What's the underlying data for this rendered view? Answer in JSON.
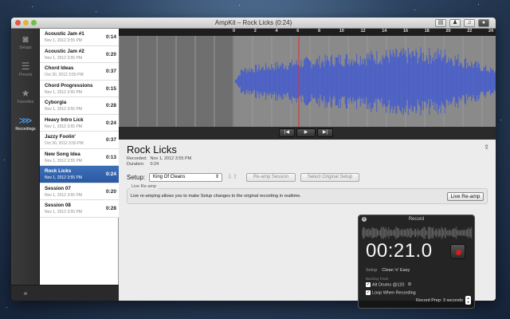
{
  "window": {
    "title": "AmpKit – Rock Licks (0:24)"
  },
  "toolbar": {
    "buttons": [
      {
        "icon": "list-icon",
        "glyph": "▤"
      },
      {
        "icon": "person-icon",
        "glyph": "♟"
      },
      {
        "icon": "music-icon",
        "glyph": "♫"
      },
      {
        "icon": "record-toggle-icon",
        "glyph": "●"
      }
    ]
  },
  "nav": {
    "items": [
      {
        "label": "Setups",
        "icon": "speaker-icon",
        "glyph": "◙"
      },
      {
        "label": "Presets",
        "icon": "sliders-icon",
        "glyph": "☰"
      },
      {
        "label": "Favorites",
        "icon": "star-icon",
        "glyph": "★"
      },
      {
        "label": "Recordings",
        "icon": "waveform-icon",
        "glyph": "⋙"
      }
    ]
  },
  "recordings": [
    {
      "name": "Acoustic Jam #1",
      "date": "Nov 1, 2012 3:55 PM",
      "duration": "0:14"
    },
    {
      "name": "Acoustic Jam #2",
      "date": "Nov 1, 2012 3:55 PM",
      "duration": "0:20"
    },
    {
      "name": "Chord Ideas",
      "date": "Oct 30, 2012 3:55 PM",
      "duration": "0:37"
    },
    {
      "name": "Chord Progressions",
      "date": "Nov 1, 2012 3:55 PM",
      "duration": "0:15"
    },
    {
      "name": "Cyborgia",
      "date": "Nov 1, 2012 3:55 PM",
      "duration": "0:28"
    },
    {
      "name": "Heavy Intro Lick",
      "date": "Nov 1, 2012 3:55 PM",
      "duration": "0:24"
    },
    {
      "name": "Jazzy Foolin'",
      "date": "Oct 30, 2012 3:55 PM",
      "duration": "0:37"
    },
    {
      "name": "New Song Idea",
      "date": "Nov 1, 2012 3:55 PM",
      "duration": "0:13"
    },
    {
      "name": "Rock Licks",
      "date": "Nov 1, 2012 3:55 PM",
      "duration": "0:24"
    },
    {
      "name": "Session 07",
      "date": "Nov 1, 2012 3:55 PM",
      "duration": "0:20"
    },
    {
      "name": "Session 08",
      "date": "Nov 1, 2012 3:55 PM",
      "duration": "0:28"
    }
  ],
  "selected_index": 8,
  "ruler": {
    "ticks": [
      "0",
      "2",
      "4",
      "6",
      "8",
      "10",
      "12",
      "14",
      "16",
      "18",
      "20",
      "22",
      "24"
    ]
  },
  "transport": {
    "prev": "|◀",
    "play": "▶",
    "next": "▶|"
  },
  "details": {
    "title": "Rock Licks",
    "recorded_label": "Recorded:",
    "recorded_value": "Nov 1, 2012 3:55 PM",
    "duration_label": "Duration:",
    "duration_value": "0:24",
    "setup_label": "Setup:",
    "setup_value": "King Of Cleans",
    "reamp_button": "Re-amp Session",
    "select_original_button": "Select Original Setup",
    "live_group_label": "Live Re-amp",
    "live_desc": "Live re-amping allows you to make Setup changes to the original recording in realtime.",
    "live_button": "Live Re-amp"
  },
  "record_hud": {
    "title": "Record",
    "timer": "00:21.0",
    "setup_label": "Setup",
    "setup_value": "Clean 'n' Easy",
    "backing_track_label": "Backing Track",
    "backing_track_value": "Alt Drums @120",
    "loop_label": "Loop When Recording",
    "prep_label": "Record Prep: 3 seconds"
  },
  "colors": {
    "waveform": "#4a5fc8",
    "selection": "#2a5aa3",
    "record_dot": "#d71c1c"
  }
}
